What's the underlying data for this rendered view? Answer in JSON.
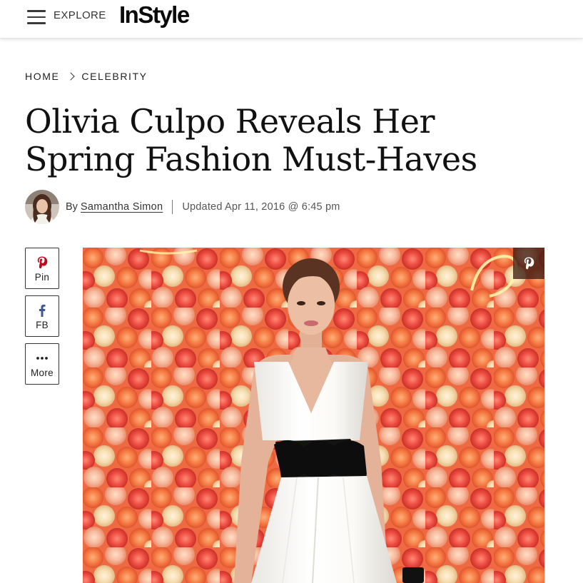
{
  "header": {
    "menu_icon": "hamburger-menu-icon",
    "explore_label": "EXPLORE",
    "logo_text": "InStyle"
  },
  "breadcrumb": {
    "items": [
      "HOME",
      "CELEBRITY"
    ],
    "separator_icon": "chevron-right-icon"
  },
  "article": {
    "headline_line1": "Olivia Culpo Reveals Her",
    "headline_line2": "Spring Fashion Must-Haves",
    "by_label": "By",
    "author": "Samantha Simon",
    "updated": "Updated Apr 11, 2016 @ 6:45 pm"
  },
  "share": {
    "pin_label": "Pin",
    "fb_label": "FB",
    "more_label": "More",
    "pin_icon": "pinterest-icon",
    "fb_icon": "facebook-icon",
    "more_icon": "ellipsis-icon"
  },
  "hero": {
    "pin_icon": "pinterest-icon"
  },
  "colors": {
    "pinterest": "#bd081c",
    "facebook": "#3b5998",
    "flower_wall": "#f06a43"
  }
}
